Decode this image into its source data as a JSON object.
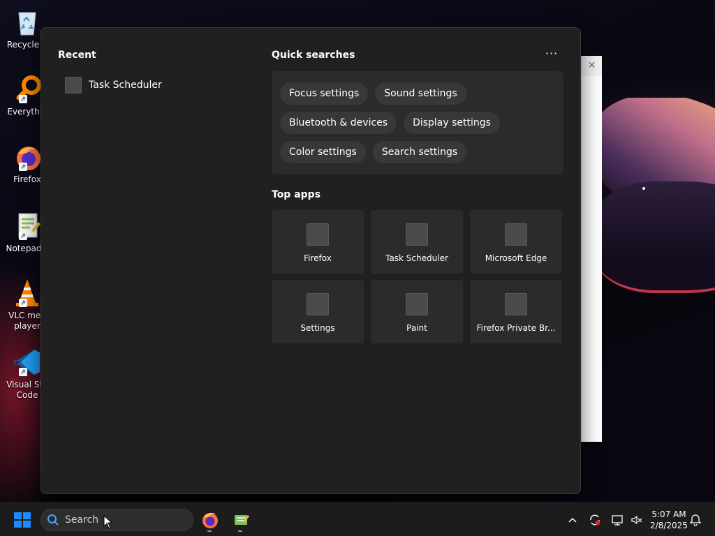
{
  "desktop": {
    "icons": [
      {
        "name": "recycle-bin",
        "label": "Recycle B",
        "icon": "recycle-bin-icon"
      },
      {
        "name": "everything",
        "label": "Everythin",
        "icon": "magnifier-icon"
      },
      {
        "name": "firefox",
        "label": "Firefox",
        "icon": "firefox-icon"
      },
      {
        "name": "notepadpp",
        "label": "Notepad+",
        "icon": "notepad-plus-plus-icon"
      },
      {
        "name": "vlc",
        "label": "VLC med\nplayer",
        "icon": "vlc-cone-icon"
      },
      {
        "name": "vscode",
        "label": "Visual Stu\nCode",
        "icon": "vscode-icon"
      }
    ]
  },
  "background_window": {
    "close_glyph": "✕"
  },
  "start_menu": {
    "recent": {
      "title": "Recent",
      "items": [
        {
          "label": "Task Scheduler"
        }
      ]
    },
    "quick_searches": {
      "title": "Quick searches",
      "more_label": "···",
      "rows": [
        [
          "Focus settings",
          "Sound settings"
        ],
        [
          "Bluetooth & devices",
          "Display settings"
        ],
        [
          "Color settings",
          "Search settings"
        ]
      ]
    },
    "top_apps": {
      "title": "Top apps",
      "apps": [
        {
          "label": "Firefox"
        },
        {
          "label": "Task Scheduler"
        },
        {
          "label": "Microsoft Edge"
        },
        {
          "label": "Settings"
        },
        {
          "label": "Paint"
        },
        {
          "label": "Firefox Private Br..."
        }
      ]
    }
  },
  "taskbar": {
    "search": {
      "placeholder": "Search",
      "value": ""
    },
    "pinned": [
      {
        "name": "firefox",
        "icon": "firefox-icon"
      },
      {
        "name": "notepadpp",
        "icon": "notepad-plus-plus-icon"
      }
    ],
    "tray": {
      "chevron": "^",
      "time": "5:07 AM",
      "date": "2/8/2025"
    }
  },
  "colors": {
    "menu_bg": "#202020",
    "panel_bg": "#2b2b2b",
    "chip_bg": "#383838",
    "taskbar_bg": "#1c1c1c",
    "windows_blue": "#1a8cff"
  }
}
